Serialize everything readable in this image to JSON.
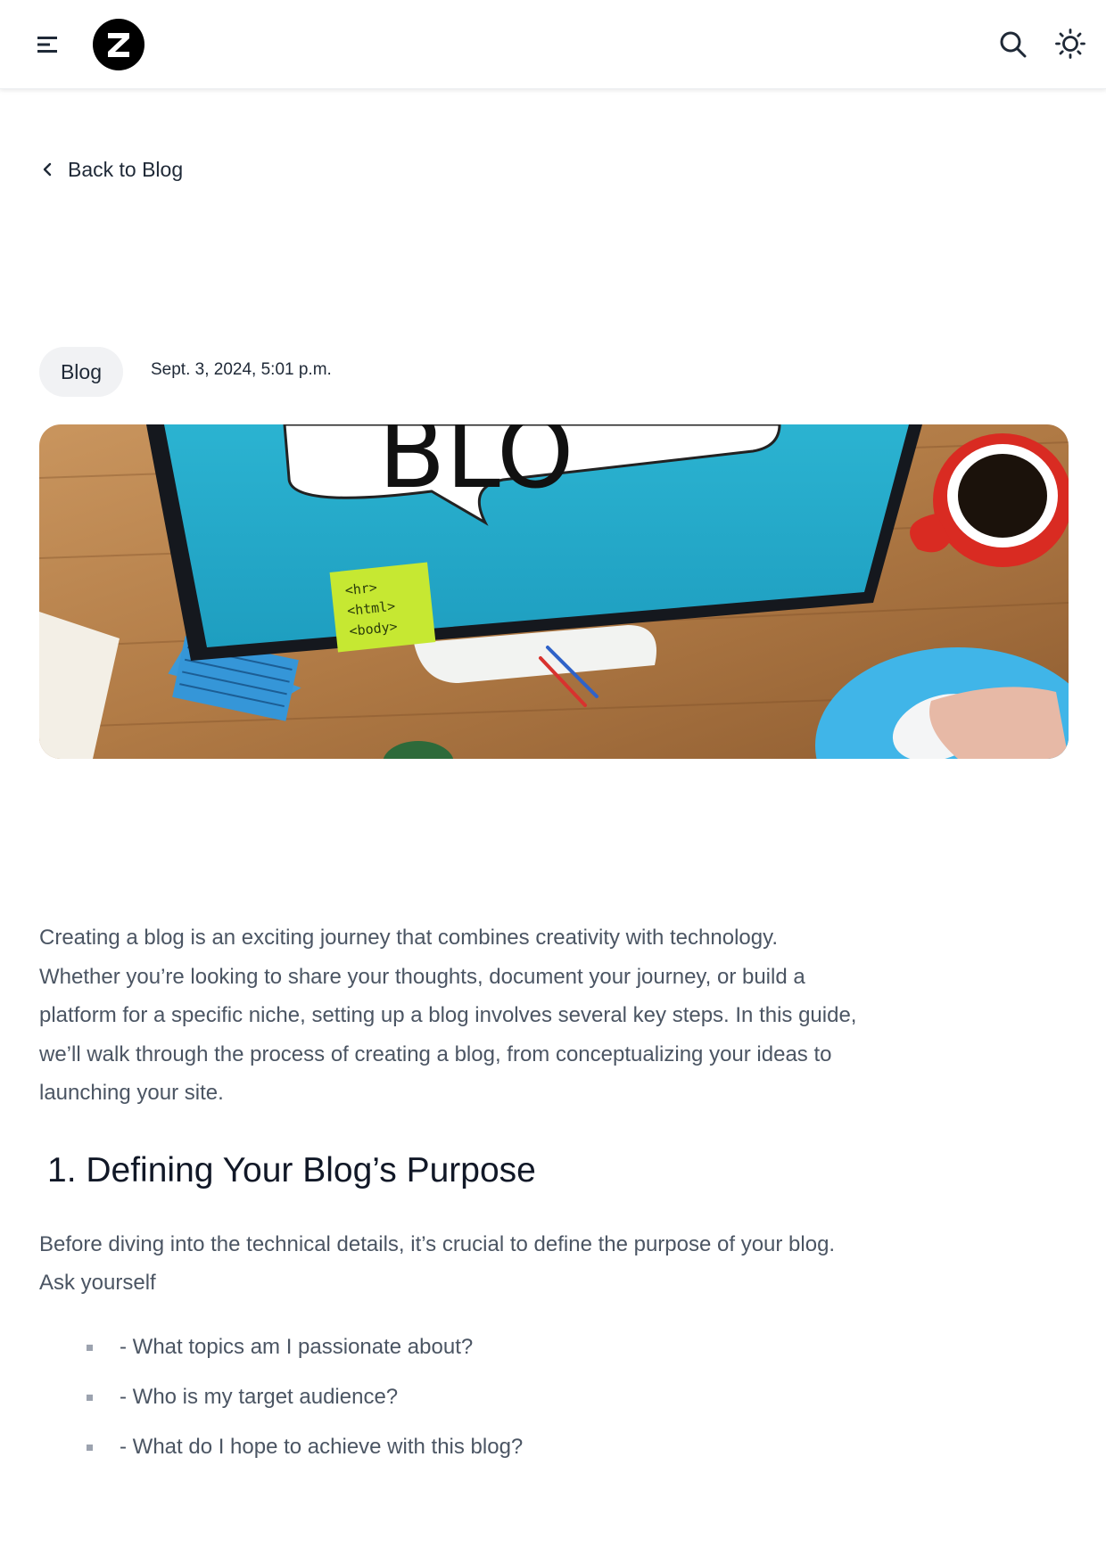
{
  "header": {
    "menu_icon": "hamburger-menu-icon",
    "logo": {
      "letter": "Z",
      "icon": "site-logo"
    },
    "search_icon": "search-icon",
    "theme_icon": "sun-icon"
  },
  "nav": {
    "back_label": "Back to Blog",
    "back_icon": "chevron-left-icon"
  },
  "post": {
    "category": "Blog",
    "date": "Sept. 3, 2024, 5:01 p.m.",
    "hero_image": {
      "scene": "monitor with speech bubble, sticky notes, paperclips, red coffee cup, mouse on wooden desk",
      "sticky_note_lines": [
        "<hr>",
        "<html>",
        "<body>"
      ]
    },
    "intro": "Creating a blog is an exciting journey that combines creativity with technology. Whether you’re looking to share your thoughts, document your journey, or build a platform for a specific niche, setting up a blog involves several key steps. In this guide, we’ll walk through the process of creating a blog, from conceptualizing your ideas to launching your site.",
    "sections": [
      {
        "heading": "1. Defining Your Blog’s Purpose",
        "text": "Before diving into the technical details, it’s crucial to define the purpose of your blog. Ask yourself",
        "questions": [
          "- What topics am I passionate about?",
          "- Who is my target audience?",
          "- What do I hope to achieve with this blog?"
        ]
      }
    ]
  },
  "colors": {
    "text_primary": "#1f2937",
    "text_body": "#4b5563",
    "pill_bg": "#f1f2f4",
    "header_bg": "#ffffff"
  }
}
